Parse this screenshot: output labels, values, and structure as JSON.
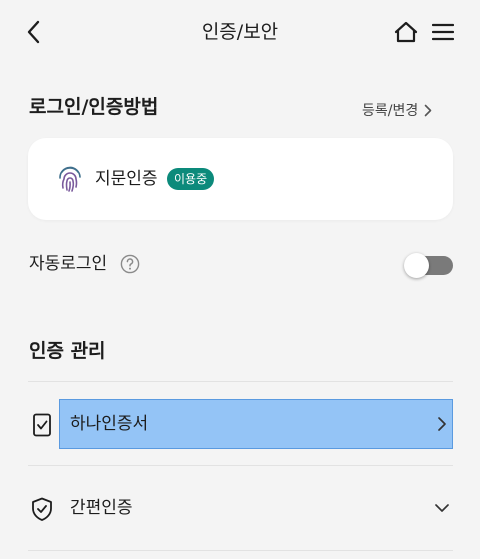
{
  "header": {
    "title": "인증/보안",
    "back_icon": "chevron-left-icon",
    "home_icon": "home-icon",
    "menu_icon": "hamburger-menu-icon"
  },
  "login_section": {
    "title": "로그인/인증방법",
    "register_link": "등록/변경",
    "method": {
      "label": "지문인증",
      "icon": "fingerprint-icon",
      "badge": "이용중",
      "badge_color": "#0c8a7b"
    }
  },
  "auto_login": {
    "label": "자동로그인",
    "help_icon": "question-circle-icon",
    "enabled": false
  },
  "auth_management": {
    "title": "인증 관리",
    "items": [
      {
        "label": "하나인증서",
        "icon": "check-badge-icon",
        "chevron": "chevron-right-icon",
        "highlighted": true
      },
      {
        "label": "간편인증",
        "icon": "shield-check-icon",
        "chevron": "chevron-down-icon",
        "highlighted": false
      }
    ]
  },
  "colors": {
    "background": "#f4f4f4",
    "card": "#ffffff",
    "accent": "#0c8a7b",
    "highlight": "#94c4f6"
  }
}
